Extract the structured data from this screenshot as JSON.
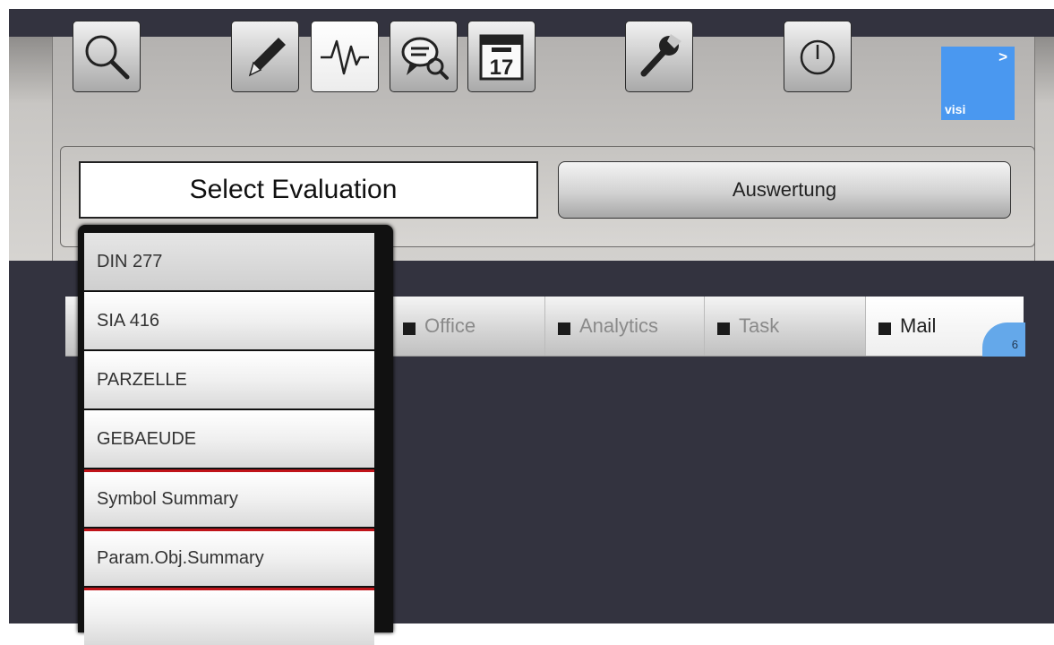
{
  "toolbar": {
    "buttons": [
      {
        "id": "search",
        "icon": "magnifier-icon"
      },
      {
        "id": "edit",
        "icon": "pen-icon"
      },
      {
        "id": "analytics",
        "icon": "waveform-icon"
      },
      {
        "id": "chat",
        "icon": "speech-bubble-search-icon"
      },
      {
        "id": "calendar",
        "icon": "calendar-icon",
        "day": "17"
      },
      {
        "id": "settings",
        "icon": "wrench-icon"
      },
      {
        "id": "power",
        "icon": "power-icon"
      }
    ],
    "visi": {
      "arrow": ">",
      "label": "visi",
      "color": "#4a98f0"
    }
  },
  "evaluation": {
    "select_label": "Select Evaluation",
    "button_label": "Auswertung"
  },
  "tabs": [
    {
      "label": "Office"
    },
    {
      "label": "Analytics"
    },
    {
      "label": "Task"
    },
    {
      "label": "Mail",
      "badge": "6",
      "active": true
    }
  ],
  "dropdown": {
    "items": [
      "DIN 277",
      "SIA 416",
      "PARZELLE",
      "GEBAEUDE",
      "Symbol Summary",
      "Param.Obj.Summary",
      ""
    ],
    "separator_color": "#c0141a"
  }
}
